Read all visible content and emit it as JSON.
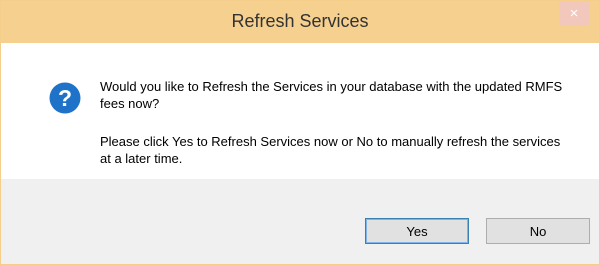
{
  "dialog": {
    "title": "Refresh Services",
    "close_symbol": "×",
    "icon": "question-icon",
    "message_line1": "Would you like to Refresh the Services in your database with the updated RMFS fees now?",
    "message_line2": "Please click Yes to Refresh Services now or No to manually refresh the services at a later time.",
    "buttons": {
      "yes_label": "Yes",
      "no_label": "No"
    }
  },
  "colors": {
    "titlebar": "#f6d08f",
    "close_button": "#f2c8bc",
    "question_icon": "#1e73c8",
    "footer": "#f0f0f0"
  }
}
